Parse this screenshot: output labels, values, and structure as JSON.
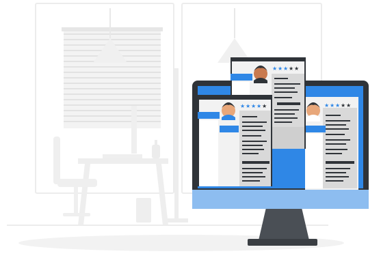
{
  "illustration": {
    "subject": "resume-review-on-monitor",
    "colors": {
      "accent": "#2f87e6",
      "accent_light": "#8dbdf0",
      "frame_dark": "#2f3338",
      "paper": "#f2f2f2",
      "panel": "#d9d9d9",
      "background_line": "#ececec"
    },
    "icons": [
      "window-icon",
      "blind-icon",
      "pendant-lamp-icon",
      "chair-icon",
      "desk-icon",
      "desk-lamp-icon",
      "bottle-icon",
      "trash-bin-icon",
      "monitor-icon",
      "resume-card-icon",
      "avatar-icon",
      "star-icon"
    ],
    "cards": [
      {
        "id": "left",
        "rating": 4,
        "stars": 5
      },
      {
        "id": "top",
        "rating": 3,
        "stars": 5
      },
      {
        "id": "right",
        "rating": 3,
        "stars": 5
      }
    ]
  }
}
